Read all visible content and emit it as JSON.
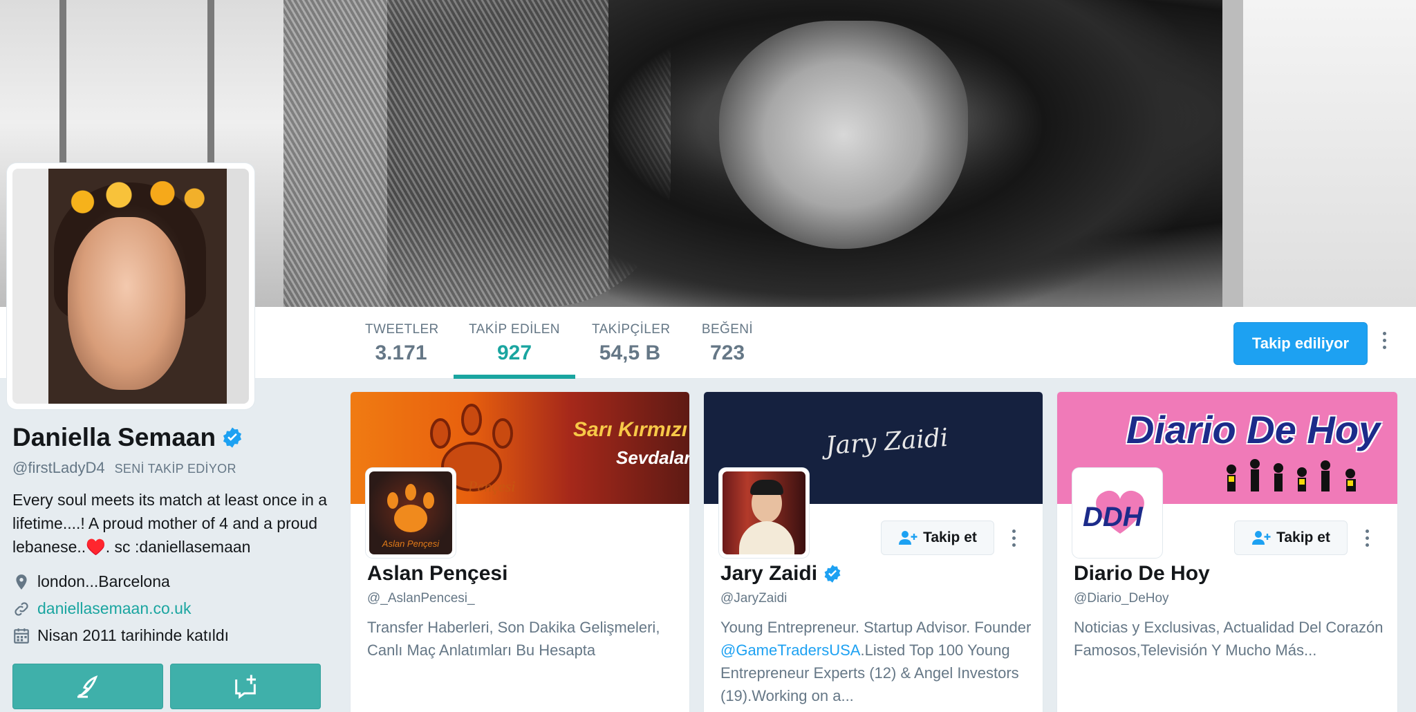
{
  "profile": {
    "name": "Daniella Semaan",
    "handle": "@firstLadyD4",
    "follows_you": "SENİ TAKİP EDİYOR",
    "bio": "Every soul meets its match at least once in a lifetime....! A proud mother of 4 and a proud lebanese..",
    "bio_emoji": "♥️",
    "bio_tail": ". sc :daniellasemaan",
    "location": "london...Barcelona",
    "website": "daniellasemaan.co.uk",
    "joined": "Nisan 2011 tarihinde katıldı"
  },
  "nav": {
    "stats": [
      {
        "label": "TWEETLER",
        "value": "3.171"
      },
      {
        "label": "TAKİP EDİLEN",
        "value": "927"
      },
      {
        "label": "TAKİPÇİLER",
        "value": "54,5 B"
      },
      {
        "label": "BEĞENİ",
        "value": "723"
      }
    ],
    "active_index": 1,
    "follow_button": "Takip ediliyor"
  },
  "colors": {
    "accent": "#1aa5a0",
    "primary_button": "#1da1f2",
    "verified": "#1da1f2"
  },
  "cards": [
    {
      "name": "Aslan Pençesi",
      "handle": "@_AslanPencesi_",
      "bio": "Transfer Haberleri, Son Dakika Gelişmeleri, Canlı Maç Anlatımları Bu Hesapta",
      "cover_text_1": "Sarı Kırmızı",
      "cover_text_2": "Sevdalar",
      "cover_watermark": "Pençesi",
      "avatar_text": "Aslan Pençesi",
      "verified": false
    },
    {
      "name": "Jary Zaidi",
      "handle": "@JaryZaidi",
      "bio_pre": "Young Entrepreneur. Startup Advisor. Founder ",
      "bio_mention": "@GameTradersUSA",
      "bio_post": ".Listed Top 100 Young Entrepreneur Experts (12) & Angel Investors (19).Working on a...",
      "cover_signature": "Jary Zaidi",
      "follow_label": "Takip et",
      "verified": true
    },
    {
      "name": "Diario De Hoy",
      "handle": "@Diario_DeHoy",
      "bio": "Noticias y Exclusivas, Actualidad Del Corazón Famosos,Televisión Y Mucho Más...",
      "cover_title": "Diario De Hoy",
      "avatar_text": "DDH",
      "follow_label": "Takip et",
      "verified": false
    }
  ]
}
